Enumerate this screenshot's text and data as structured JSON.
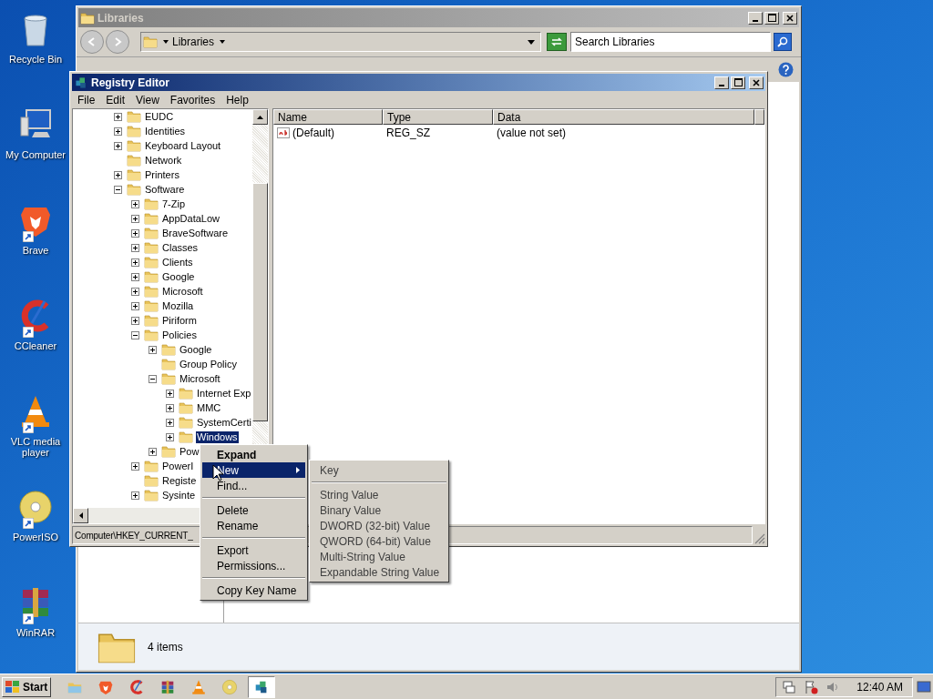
{
  "desktop_icons": [
    {
      "label": "Recycle Bin",
      "kind": "recycle",
      "shortcut": false
    },
    {
      "label": "My Computer",
      "kind": "computer",
      "shortcut": false
    },
    {
      "label": "Brave",
      "kind": "brave",
      "shortcut": true
    },
    {
      "label": "CCleaner",
      "kind": "ccleaner",
      "shortcut": true
    },
    {
      "label": "VLC media player",
      "kind": "vlc",
      "shortcut": true
    },
    {
      "label": "PowerISO",
      "kind": "poweriso",
      "shortcut": true
    },
    {
      "label": "WinRAR",
      "kind": "winrar",
      "shortcut": true
    }
  ],
  "libraries_window": {
    "title": "Libraries",
    "breadcrumb": "Libraries",
    "search": {
      "placeholder": "Search Libraries"
    },
    "status": "4 items"
  },
  "registry_editor": {
    "title": "Registry Editor",
    "menu": [
      "File",
      "Edit",
      "View",
      "Favorites",
      "Help"
    ],
    "tree": [
      {
        "label": "EUDC",
        "kind": "node",
        "expanded": false,
        "selected": false
      },
      {
        "label": "Identities",
        "kind": "node",
        "expanded": false,
        "selected": false
      },
      {
        "label": "Keyboard Layout",
        "kind": "node",
        "expanded": false,
        "selected": false
      },
      {
        "label": "Network",
        "kind": "leaf",
        "selected": false
      },
      {
        "label": "Printers",
        "kind": "node",
        "expanded": false,
        "selected": false
      },
      {
        "label": "Software",
        "kind": "node",
        "expanded": true,
        "selected": false,
        "children": [
          {
            "label": "7-Zip",
            "kind": "node",
            "expanded": false,
            "selected": false
          },
          {
            "label": "AppDataLow",
            "kind": "node",
            "expanded": false,
            "selected": false
          },
          {
            "label": "BraveSoftware",
            "kind": "node",
            "expanded": false,
            "selected": false
          },
          {
            "label": "Classes",
            "kind": "node",
            "expanded": false,
            "selected": false
          },
          {
            "label": "Clients",
            "kind": "node",
            "expanded": false,
            "selected": false
          },
          {
            "label": "Google",
            "kind": "node",
            "expanded": false,
            "selected": false
          },
          {
            "label": "Microsoft",
            "kind": "node",
            "expanded": false,
            "selected": false
          },
          {
            "label": "Mozilla",
            "kind": "node",
            "expanded": false,
            "selected": false
          },
          {
            "label": "Piriform",
            "kind": "node",
            "expanded": false,
            "selected": false
          },
          {
            "label": "Policies",
            "kind": "node",
            "expanded": true,
            "selected": false,
            "children": [
              {
                "label": "Google",
                "kind": "node",
                "expanded": false,
                "selected": false
              },
              {
                "label": "Group Policy",
                "kind": "leaf",
                "selected": false
              },
              {
                "label": "Microsoft",
                "kind": "node",
                "expanded": true,
                "selected": false,
                "children": [
                  {
                    "label": "Internet Exp",
                    "kind": "node",
                    "expanded": false,
                    "selected": false
                  },
                  {
                    "label": "MMC",
                    "kind": "node",
                    "expanded": false,
                    "selected": false
                  },
                  {
                    "label": "SystemCerti",
                    "kind": "node",
                    "expanded": false,
                    "selected": false
                  },
                  {
                    "label": "Windows",
                    "kind": "node",
                    "expanded": false,
                    "selected": true
                  }
                ]
              },
              {
                "label": "Pow",
                "kind": "node",
                "expanded": false,
                "selected": false
              }
            ]
          },
          {
            "label": "PowerI",
            "kind": "node",
            "expanded": false,
            "selected": false
          },
          {
            "label": "Registe",
            "kind": "leaf",
            "selected": false
          },
          {
            "label": "Sysinte",
            "kind": "node",
            "expanded": false,
            "selected": false
          }
        ]
      }
    ],
    "columns": [
      "Name",
      "Type",
      "Data"
    ],
    "rows": [
      {
        "name": "(Default)",
        "type": "REG_SZ",
        "data": "(value not set)"
      }
    ],
    "status_bar": "Computer\\HKEY_CURRENT_"
  },
  "context_menu": [
    {
      "kind": "item",
      "label": "Expand",
      "bold": true,
      "submenu": false,
      "selected": false
    },
    {
      "kind": "item",
      "label": "New",
      "bold": false,
      "submenu": true,
      "selected": true
    },
    {
      "kind": "item",
      "label": "Find...",
      "bold": false,
      "submenu": false,
      "selected": false
    },
    {
      "kind": "separator"
    },
    {
      "kind": "item",
      "label": "Delete",
      "bold": false,
      "submenu": false,
      "selected": false
    },
    {
      "kind": "item",
      "label": "Rename",
      "bold": false,
      "submenu": false,
      "selected": false
    },
    {
      "kind": "separator"
    },
    {
      "kind": "item",
      "label": "Export",
      "bold": false,
      "submenu": false,
      "selected": false
    },
    {
      "kind": "item",
      "label": "Permissions...",
      "bold": false,
      "submenu": false,
      "selected": false
    },
    {
      "kind": "separator"
    },
    {
      "kind": "item",
      "label": "Copy Key Name",
      "bold": false,
      "submenu": false,
      "selected": false
    }
  ],
  "submenu": [
    {
      "kind": "item",
      "label": "Key",
      "selected": false
    },
    {
      "kind": "separator"
    },
    {
      "kind": "item",
      "label": "String Value",
      "selected": false
    },
    {
      "kind": "item",
      "label": "Binary Value",
      "selected": false
    },
    {
      "kind": "item",
      "label": "DWORD (32-bit) Value",
      "selected": false
    },
    {
      "kind": "item",
      "label": "QWORD (64-bit) Value",
      "selected": false
    },
    {
      "kind": "item",
      "label": "Multi-String Value",
      "selected": false
    },
    {
      "kind": "item",
      "label": "Expandable String Value",
      "selected": false
    }
  ],
  "taskbar": {
    "start": "Start",
    "apps": [
      {
        "kind": "explorer",
        "active": false
      },
      {
        "kind": "brave",
        "active": false
      },
      {
        "kind": "ccleaner",
        "active": false
      },
      {
        "kind": "winrar",
        "active": false
      },
      {
        "kind": "vlc",
        "active": false
      },
      {
        "kind": "poweriso",
        "active": false
      },
      {
        "kind": "regedit",
        "active": true
      }
    ],
    "clock": "12:40 AM"
  }
}
